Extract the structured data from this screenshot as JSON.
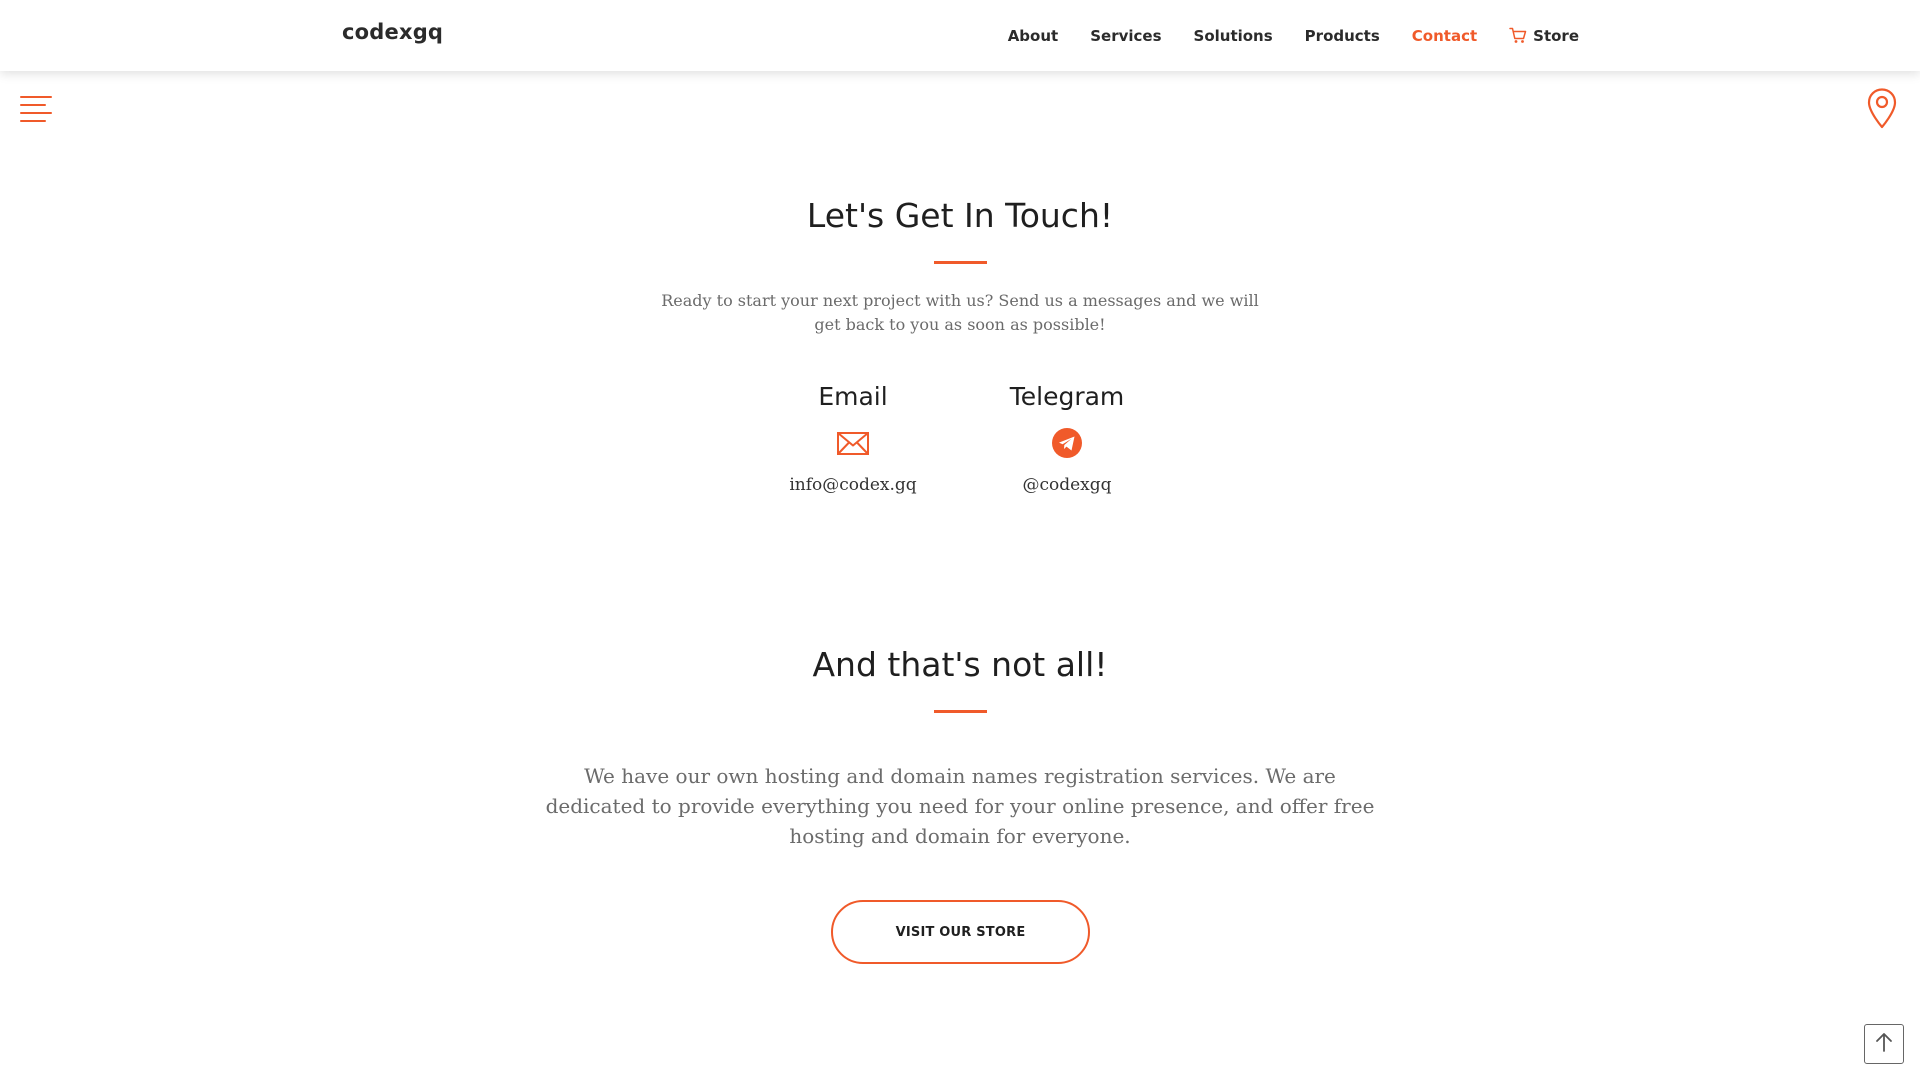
{
  "header": {
    "brand": "codexgq",
    "nav": [
      {
        "label": "About",
        "active": false
      },
      {
        "label": "Services",
        "active": false
      },
      {
        "label": "Solutions",
        "active": false
      },
      {
        "label": "Products",
        "active": false
      },
      {
        "label": "Contact",
        "active": true
      },
      {
        "label": "Store",
        "active": false,
        "icon": "cart-icon"
      }
    ]
  },
  "side_controls": {
    "menu_icon": "hamburger-menu-icon",
    "location_icon": "map-pin-icon"
  },
  "contact_section": {
    "title": "Let's Get In Touch!",
    "lead_line1": "Ready to start your next project with us? Send us a messages and we will",
    "lead_line2": "get back to you as soon as possible!",
    "methods": [
      {
        "label": "Email",
        "icon": "envelope-icon",
        "value": "info@codex.gq"
      },
      {
        "label": "Telegram",
        "icon": "telegram-icon",
        "value": "@codexgq"
      }
    ]
  },
  "more_section": {
    "title": "And that's not all!",
    "line1": "We have our own hosting and domain names registration services. We are",
    "line2": "dedicated to provide everything you need for your online presence, and offer free",
    "line3": "hosting and domain for everyone.",
    "button_label": "VISIT OUR STORE"
  },
  "back_to_top_icon": "arrow-up-icon",
  "colors": {
    "accent": "#f05a2a",
    "heading": "#1f1f1f",
    "muted_text": "#6b6b6b"
  }
}
